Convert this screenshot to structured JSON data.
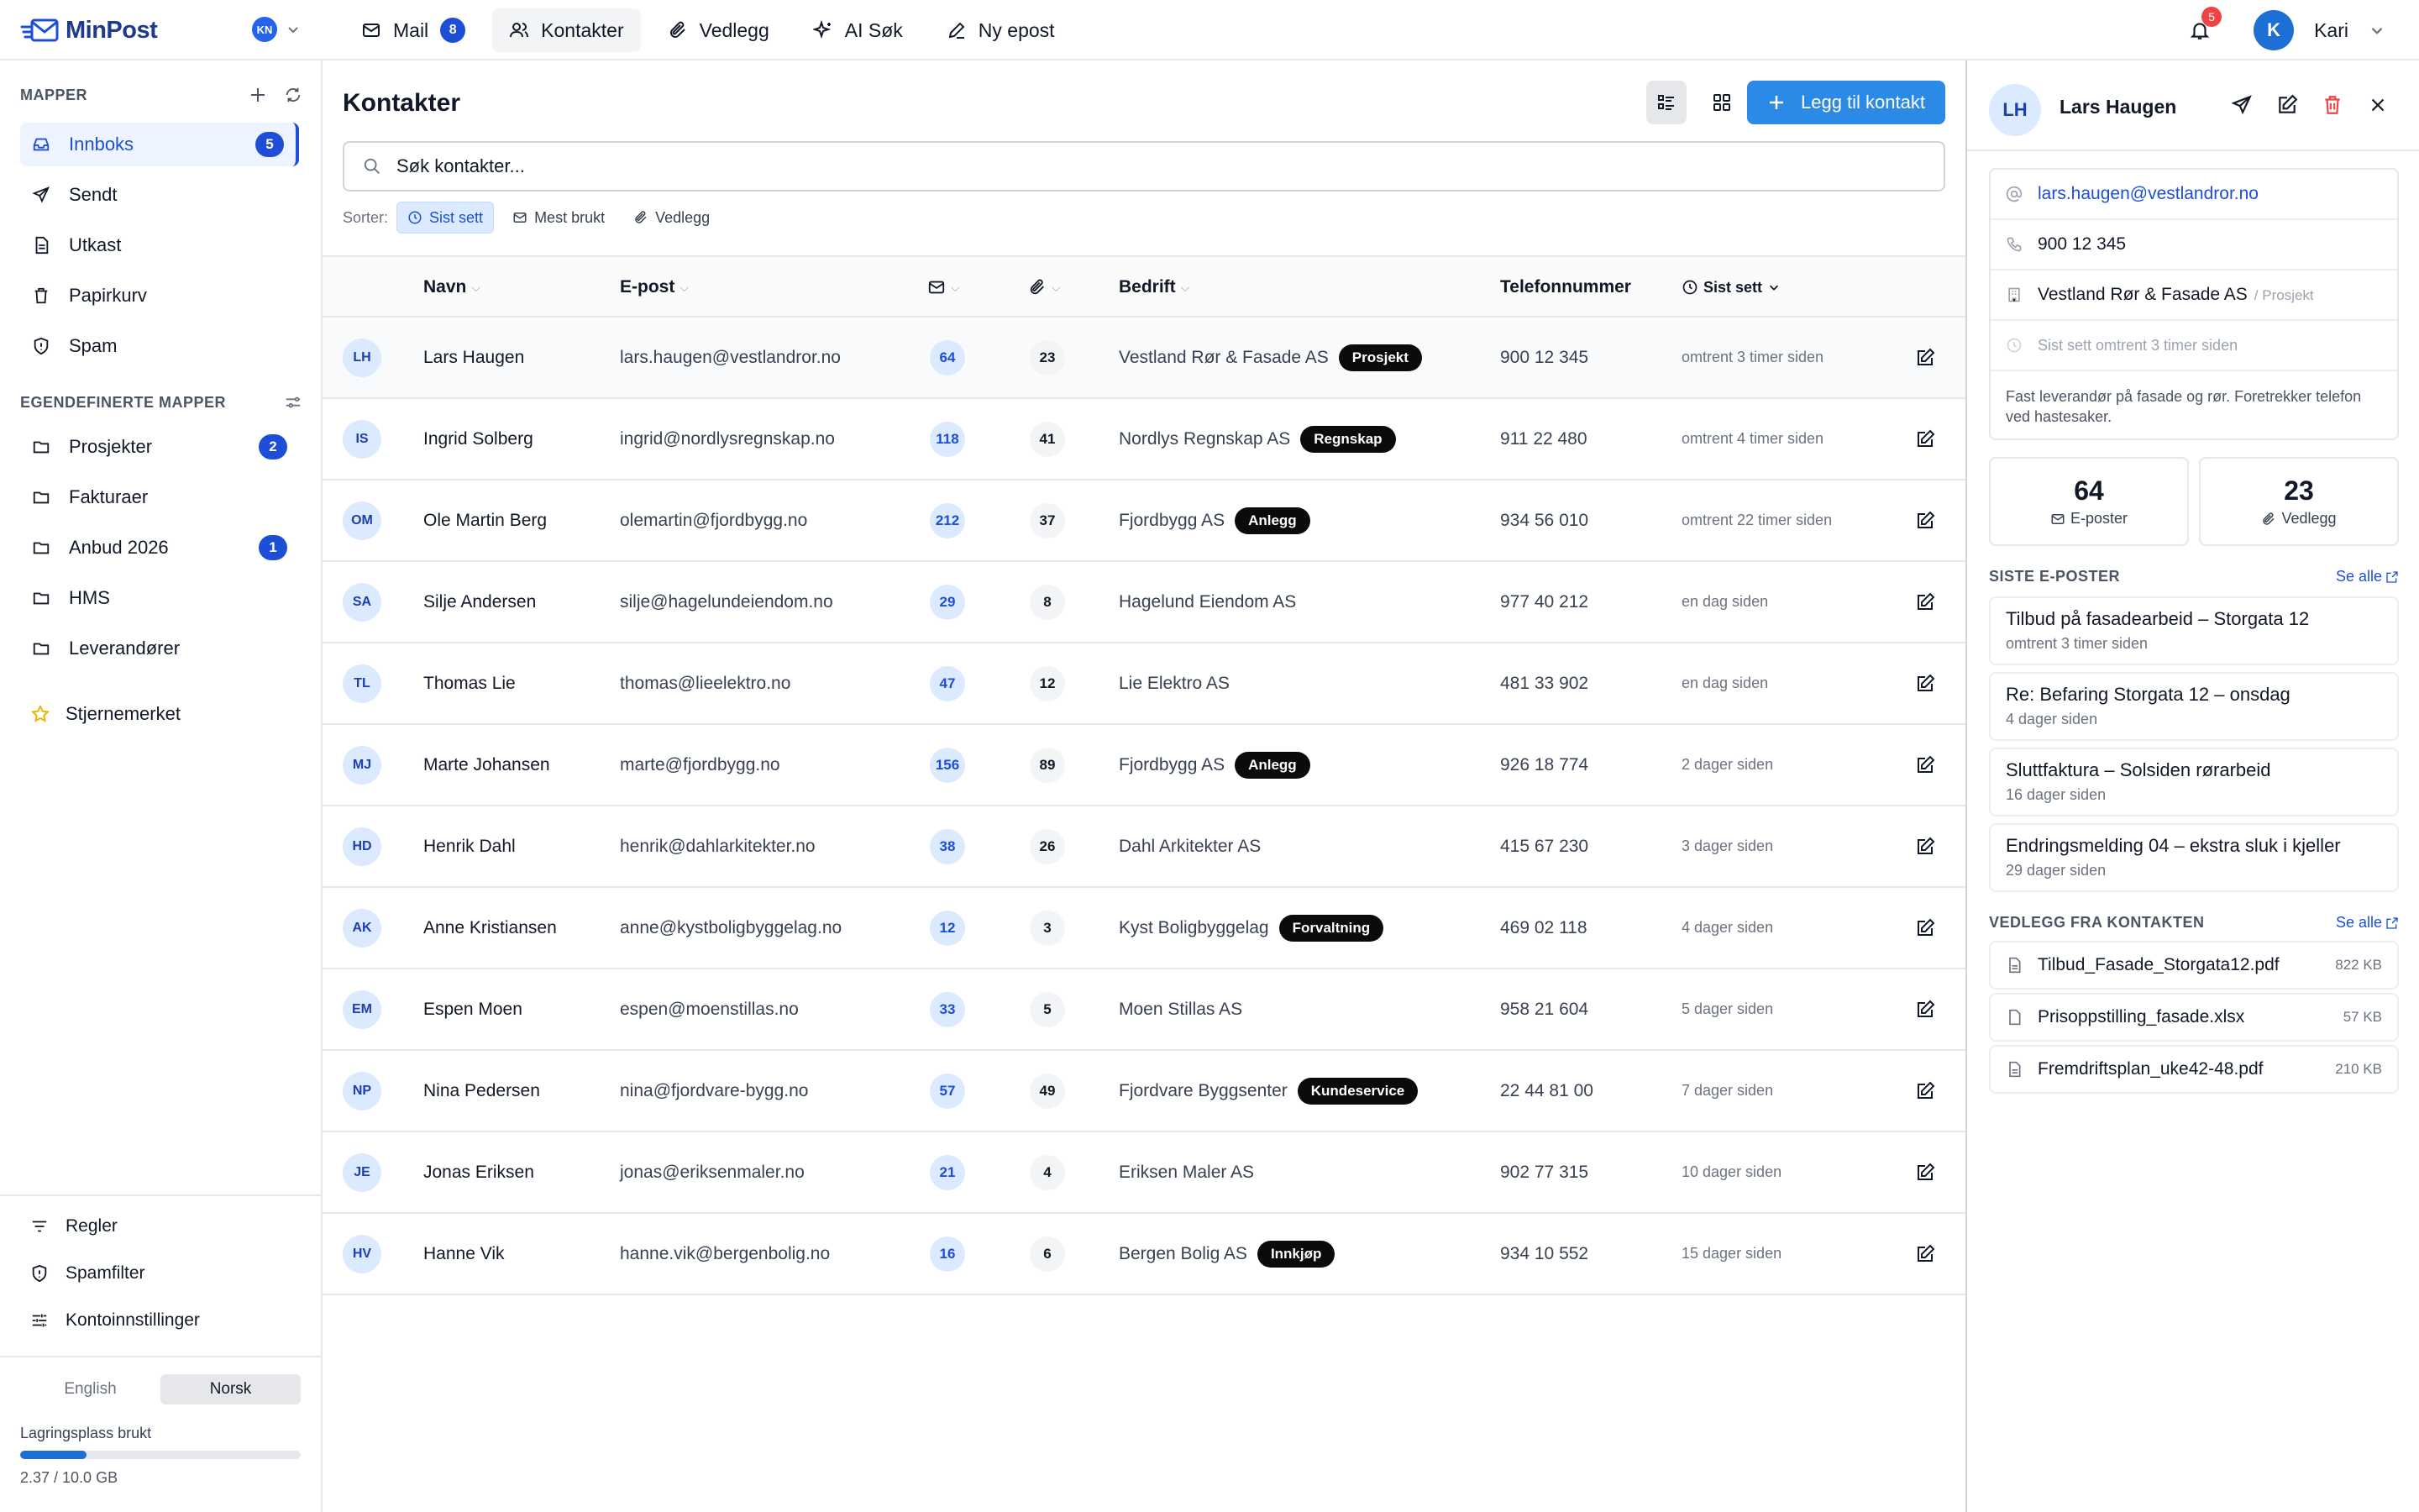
{
  "app": {
    "name": "MinPost",
    "account_initials": "KN"
  },
  "nav": [
    {
      "label": "Mail",
      "badge": "8",
      "icon": "mail-icon"
    },
    {
      "label": "Kontakter",
      "badge": "",
      "icon": "contacts-icon"
    },
    {
      "label": "Vedlegg",
      "badge": "",
      "icon": "paperclip-icon"
    },
    {
      "label": "AI Søk",
      "badge": "",
      "icon": "sparkle-icon"
    },
    {
      "label": "Ny epost",
      "badge": "",
      "icon": "pencil-icon"
    }
  ],
  "topright": {
    "notifications": "5",
    "user_initial": "K",
    "user_name": "Kari"
  },
  "sidebar": {
    "folders_heading": "MAPPER",
    "folders": [
      {
        "label": "Innboks",
        "count": "5",
        "icon": "inbox-icon"
      },
      {
        "label": "Sendt",
        "count": "",
        "icon": "send-icon"
      },
      {
        "label": "Utkast",
        "count": "",
        "icon": "draft-icon"
      },
      {
        "label": "Papirkurv",
        "count": "",
        "icon": "trash-icon"
      },
      {
        "label": "Spam",
        "count": "",
        "icon": "shield-icon"
      }
    ],
    "custom_heading": "EGENDEFINERTE MAPPER",
    "custom": [
      {
        "label": "Prosjekter",
        "count": "2"
      },
      {
        "label": "Fakturaer",
        "count": ""
      },
      {
        "label": "Anbud 2026",
        "count": "1"
      },
      {
        "label": "HMS",
        "count": ""
      },
      {
        "label": "Leverandører",
        "count": ""
      }
    ],
    "starred": "Stjernemerket",
    "footer": [
      {
        "label": "Regler",
        "icon": "filter-icon"
      },
      {
        "label": "Spamfilter",
        "icon": "shield-icon"
      },
      {
        "label": "Kontoinnstillinger",
        "icon": "sliders-icon"
      }
    ],
    "languages": [
      "English",
      "Norsk"
    ],
    "storage": {
      "label": "Lagringsplass brukt",
      "used_text": "2.37 / 10.0 GB",
      "fraction": 0.237
    }
  },
  "main": {
    "title": "Kontakter",
    "add_label": "Legg til kontakt",
    "search_placeholder": "Søk kontakter...",
    "sort_label": "Sorter:",
    "sort_options": [
      "Sist sett",
      "Mest brukt",
      "Vedlegg"
    ],
    "columns": {
      "name": "Navn",
      "email": "E-post",
      "company": "Bedrift",
      "phone": "Telefonnummer",
      "seen": "Sist sett"
    },
    "contacts": [
      {
        "initials": "LH",
        "name": "Lars Haugen",
        "email": "lars.haugen@vestlandror.no",
        "mails": "64",
        "attachments": "23",
        "company": "Vestland Rør & Fasade AS",
        "tag": "Prosjekt",
        "phone": "900 12 345",
        "seen": "omtrent 3 timer siden"
      },
      {
        "initials": "IS",
        "name": "Ingrid Solberg",
        "email": "ingrid@nordlysregnskap.no",
        "mails": "118",
        "attachments": "41",
        "company": "Nordlys Regnskap AS",
        "tag": "Regnskap",
        "phone": "911 22 480",
        "seen": "omtrent 4 timer siden"
      },
      {
        "initials": "OM",
        "name": "Ole Martin Berg",
        "email": "olemartin@fjordbygg.no",
        "mails": "212",
        "attachments": "37",
        "company": "Fjordbygg AS",
        "tag": "Anlegg",
        "phone": "934 56 010",
        "seen": "omtrent 22 timer siden"
      },
      {
        "initials": "SA",
        "name": "Silje Andersen",
        "email": "silje@hagelundeiendom.no",
        "mails": "29",
        "attachments": "8",
        "company": "Hagelund Eiendom AS",
        "tag": "",
        "phone": "977 40 212",
        "seen": "en dag siden"
      },
      {
        "initials": "TL",
        "name": "Thomas Lie",
        "email": "thomas@lieelektro.no",
        "mails": "47",
        "attachments": "12",
        "company": "Lie Elektro AS",
        "tag": "",
        "phone": "481 33 902",
        "seen": "en dag siden"
      },
      {
        "initials": "MJ",
        "name": "Marte Johansen",
        "email": "marte@fjordbygg.no",
        "mails": "156",
        "attachments": "89",
        "company": "Fjordbygg AS",
        "tag": "Anlegg",
        "phone": "926 18 774",
        "seen": "2 dager siden"
      },
      {
        "initials": "HD",
        "name": "Henrik Dahl",
        "email": "henrik@dahlarkitekter.no",
        "mails": "38",
        "attachments": "26",
        "company": "Dahl Arkitekter AS",
        "tag": "",
        "phone": "415 67 230",
        "seen": "3 dager siden"
      },
      {
        "initials": "AK",
        "name": "Anne Kristiansen",
        "email": "anne@kystboligbyggelag.no",
        "mails": "12",
        "attachments": "3",
        "company": "Kyst Boligbyggelag",
        "tag": "Forvaltning",
        "phone": "469 02 118",
        "seen": "4 dager siden"
      },
      {
        "initials": "EM",
        "name": "Espen Moen",
        "email": "espen@moenstillas.no",
        "mails": "33",
        "attachments": "5",
        "company": "Moen Stillas AS",
        "tag": "",
        "phone": "958 21 604",
        "seen": "5 dager siden"
      },
      {
        "initials": "NP",
        "name": "Nina Pedersen",
        "email": "nina@fjordvare-bygg.no",
        "mails": "57",
        "attachments": "49",
        "company": "Fjordvare Byggsenter",
        "tag": "Kundeservice",
        "phone": "22 44 81 00",
        "seen": "7 dager siden"
      },
      {
        "initials": "JE",
        "name": "Jonas Eriksen",
        "email": "jonas@eriksenmaler.no",
        "mails": "21",
        "attachments": "4",
        "company": "Eriksen Maler AS",
        "tag": "",
        "phone": "902 77 315",
        "seen": "10 dager siden"
      },
      {
        "initials": "HV",
        "name": "Hanne Vik",
        "email": "hanne.vik@bergenbolig.no",
        "mails": "16",
        "attachments": "6",
        "company": "Bergen Bolig AS",
        "tag": "Innkjøp",
        "phone": "934 10 552",
        "seen": "15 dager siden"
      }
    ]
  },
  "detail": {
    "initials": "LH",
    "name": "Lars Haugen",
    "email": "lars.haugen@vestlandror.no",
    "phone": "900 12 345",
    "company": "Vestland Rør & Fasade AS",
    "company_tag": "/ Prosjekt",
    "seen": "Sist sett omtrent 3 timer siden",
    "note": "Fast leverandør på fasade og rør. Foretrekker telefon ved hastesaker.",
    "stat_mails": "64",
    "stat_mails_label": "E-poster",
    "stat_att": "23",
    "stat_att_label": "Vedlegg",
    "recent_heading": "SISTE E-POSTER",
    "see_all": "Se alle",
    "recent": [
      {
        "subject": "Tilbud på fasadearbeid – Storgata 12",
        "when": "omtrent 3 timer siden"
      },
      {
        "subject": "Re: Befaring Storgata 12 – onsdag",
        "when": "4 dager siden"
      },
      {
        "subject": "Sluttfaktura – Solsiden rørarbeid",
        "when": "16 dager siden"
      },
      {
        "subject": "Endringsmelding 04 – ekstra sluk i kjeller",
        "when": "29 dager siden"
      }
    ],
    "att_heading": "VEDLEGG FRA KONTAKTEN",
    "attachments": [
      {
        "name": "Tilbud_Fasade_Storgata12.pdf",
        "size": "822 KB"
      },
      {
        "name": "Prisoppstilling_fasade.xlsx",
        "size": "57 KB"
      },
      {
        "name": "Fremdriftsplan_uke42-48.pdf",
        "size": "210 KB"
      }
    ]
  },
  "colors": {
    "accent": "#1d4ed8",
    "button": "#2b8ae6",
    "tag": "#0b0b0b",
    "danger": "#ef4444"
  }
}
